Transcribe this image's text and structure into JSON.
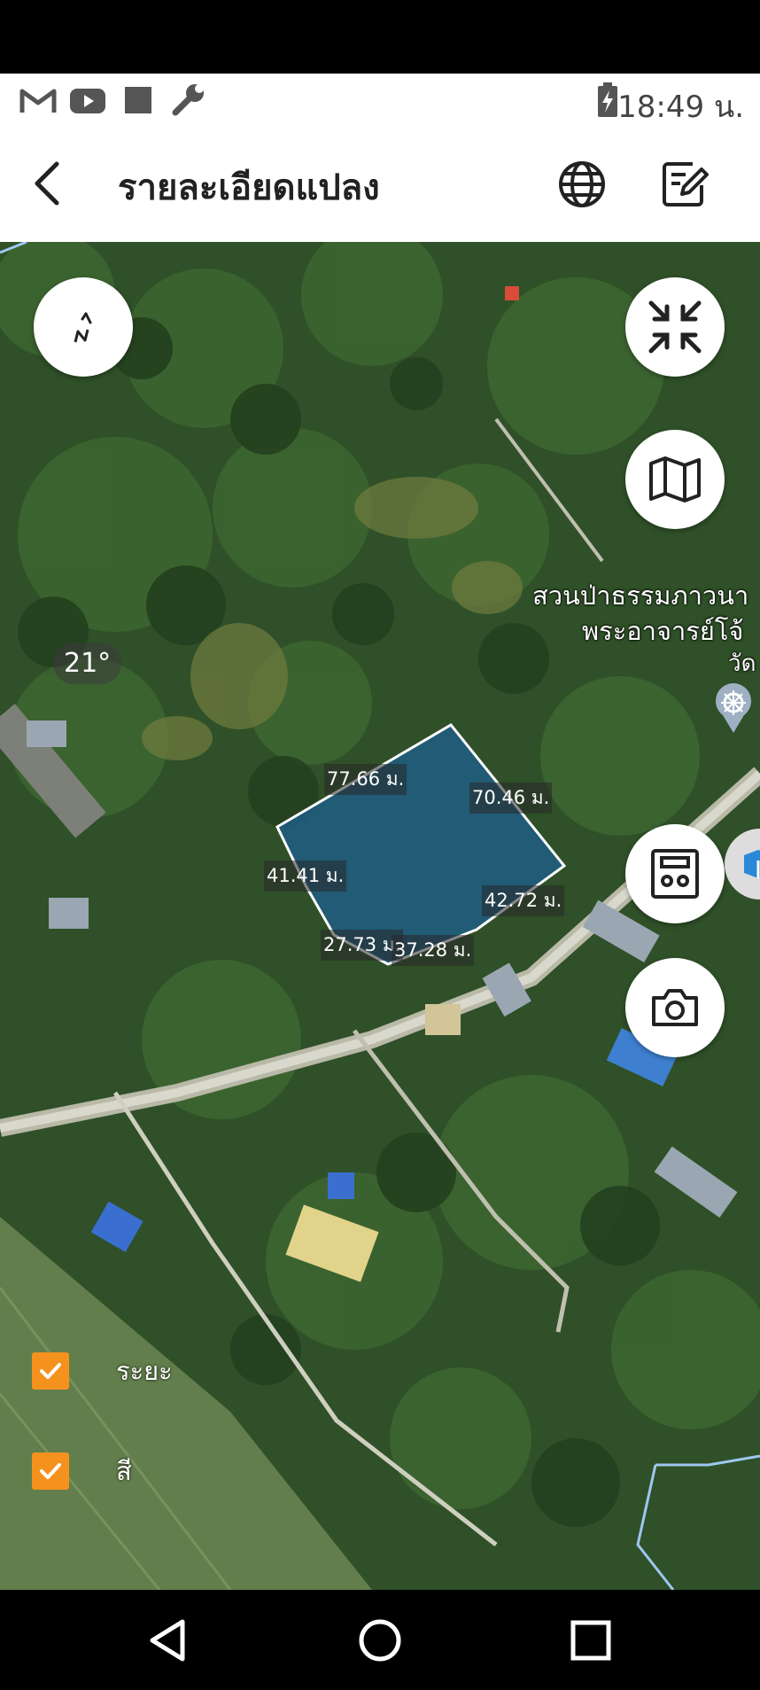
{
  "status_bar": {
    "time": "18:49 น.",
    "icons": [
      "gmail-icon",
      "youtube-icon",
      "square-notification-icon",
      "wrench-icon",
      "battery-charging-icon"
    ]
  },
  "app_bar": {
    "title": "รายละเอียดแปลง",
    "icons": [
      "back-arrow-icon",
      "globe-icon",
      "edit-note-icon"
    ]
  },
  "map": {
    "compass_bearing": "21°",
    "place_labels": {
      "line1": "สวนป่าธรรมภาวนา",
      "line2": "พระอาจารย์โจ้",
      "line3": "วัด"
    },
    "plot_dimensions": [
      "77.66 ม.",
      "70.46 ม.",
      "41.41 ม.",
      "42.72 ม.",
      "27.73 ม.",
      "37.28 ม."
    ],
    "plot_fill_color": "#1e5f8c",
    "toggles": [
      {
        "label": "ระยะ",
        "checked": true
      },
      {
        "label": "สี",
        "checked": true
      }
    ],
    "accent_color": "#f5921e",
    "buttons": [
      "collapse-icon",
      "map-layers-icon",
      "calculator-icon",
      "camera-icon"
    ]
  },
  "nav_bar": {
    "buttons": [
      "back-triangle-icon",
      "home-circle-icon",
      "recents-square-icon"
    ]
  }
}
